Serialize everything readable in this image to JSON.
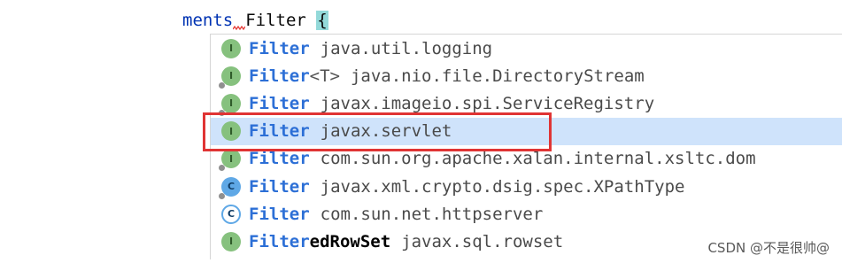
{
  "editor": {
    "line_prefix": "ments",
    "typed": "Filter",
    "brace": "{"
  },
  "completion": {
    "items": [
      {
        "icon": "interface",
        "match": "Filter",
        "suffix": "",
        "type_param": "",
        "package": "java.util.logging",
        "pinned": false,
        "selected": false
      },
      {
        "icon": "interface",
        "match": "Filter",
        "suffix": "",
        "type_param": "<T>",
        "package": "java.nio.file.DirectoryStream",
        "pinned": true,
        "selected": false
      },
      {
        "icon": "interface",
        "match": "Filter",
        "suffix": "",
        "type_param": "",
        "package": "javax.imageio.spi.ServiceRegistry",
        "pinned": true,
        "selected": false
      },
      {
        "icon": "interface",
        "match": "Filter",
        "suffix": "",
        "type_param": "",
        "package": "javax.servlet",
        "pinned": false,
        "selected": true
      },
      {
        "icon": "interface",
        "match": "Filter",
        "suffix": "",
        "type_param": "",
        "package": "com.sun.org.apache.xalan.internal.xsltc.dom",
        "pinned": true,
        "selected": false
      },
      {
        "icon": "class",
        "match": "Filter",
        "suffix": "",
        "type_param": "",
        "package": "javax.xml.crypto.dsig.spec.XPathType",
        "pinned": true,
        "selected": false
      },
      {
        "icon": "class-abstract",
        "match": "Filter",
        "suffix": "",
        "type_param": "",
        "package": "com.sun.net.httpserver",
        "pinned": false,
        "selected": false
      },
      {
        "icon": "interface",
        "match": "Filter",
        "suffix": "edRowSet",
        "type_param": "",
        "package": "javax.sql.rowset",
        "pinned": false,
        "selected": false
      }
    ]
  },
  "icon_letters": {
    "interface": "I",
    "class": "C",
    "class-abstract": "C"
  },
  "watermark": "CSDN @不是很帅@",
  "colors": {
    "selection": "#cfe3fb",
    "highlight_box": "#e03434",
    "match_text": "#2c6fd6"
  }
}
